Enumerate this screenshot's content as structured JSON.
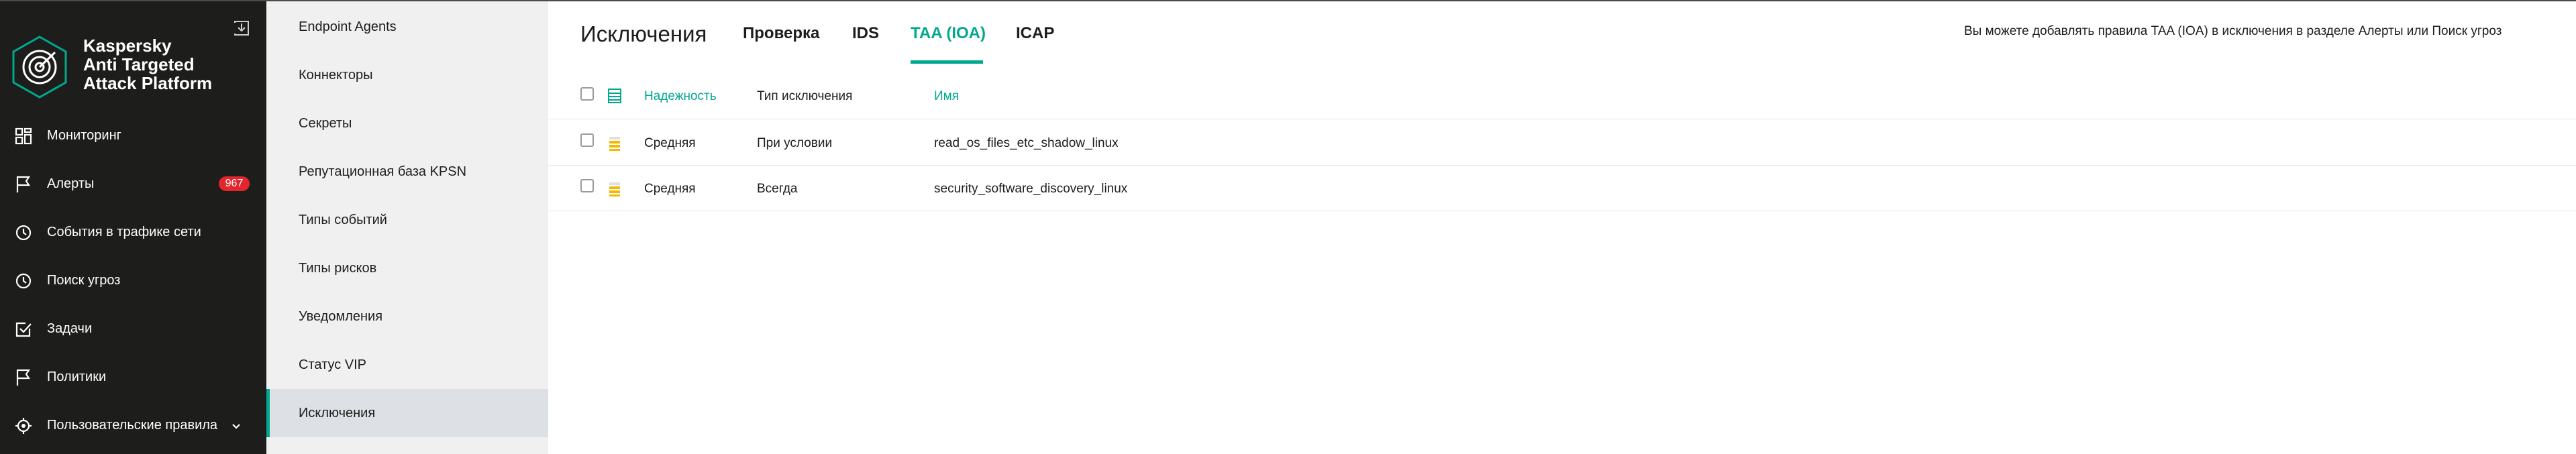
{
  "app": {
    "brand_name": "Kaspersky\nAnti Targeted\nAttack Platform"
  },
  "nav": {
    "items": [
      {
        "label": "Мониторинг",
        "icon": "dashboard-icon"
      },
      {
        "label": "Алерты",
        "icon": "flag-icon",
        "badge": "967"
      },
      {
        "label": "События в трафике сети",
        "icon": "network-events-icon"
      },
      {
        "label": "Поиск угроз",
        "icon": "threat-hunting-icon"
      },
      {
        "label": "Задачи",
        "icon": "tasks-check-icon"
      },
      {
        "label": "Политики",
        "icon": "policies-flag-icon"
      },
      {
        "label": "Пользовательские правила",
        "icon": "custom-rules-icon",
        "expanded": true
      }
    ]
  },
  "submenu": {
    "items": [
      {
        "label": "Endpoint Agents"
      },
      {
        "label": "Коннекторы"
      },
      {
        "label": "Секреты"
      },
      {
        "label": "Репутационная база KPSN"
      },
      {
        "label": "Типы событий"
      },
      {
        "label": "Типы рисков"
      },
      {
        "label": "Уведомления"
      },
      {
        "label": "Статус VIP"
      },
      {
        "label": "Исключения",
        "active": true
      }
    ]
  },
  "main": {
    "title": "Исключения",
    "tabs": [
      {
        "label": "Проверка"
      },
      {
        "label": "IDS"
      },
      {
        "label": "TAA (IOA)",
        "active": true
      },
      {
        "label": "ICAP"
      }
    ],
    "hint": "Вы можете добавлять правила TAA (IOA) в исключения в разделе Алерты или Поиск угроз",
    "table": {
      "columns": [
        "Надежность",
        "Тип исключения",
        "Имя"
      ],
      "rows": [
        {
          "reliability": "Средняя",
          "type": "При условии",
          "name": "read_os_files_etc_shadow_linux"
        },
        {
          "reliability": "Средняя",
          "type": "Всегда",
          "name": "security_software_discovery_linux"
        }
      ]
    }
  },
  "colors": {
    "accent": "#00a88e",
    "nav_bg": "#1d1d1b",
    "badge": "#e3262e",
    "reliability_medium": "#f5b800"
  }
}
